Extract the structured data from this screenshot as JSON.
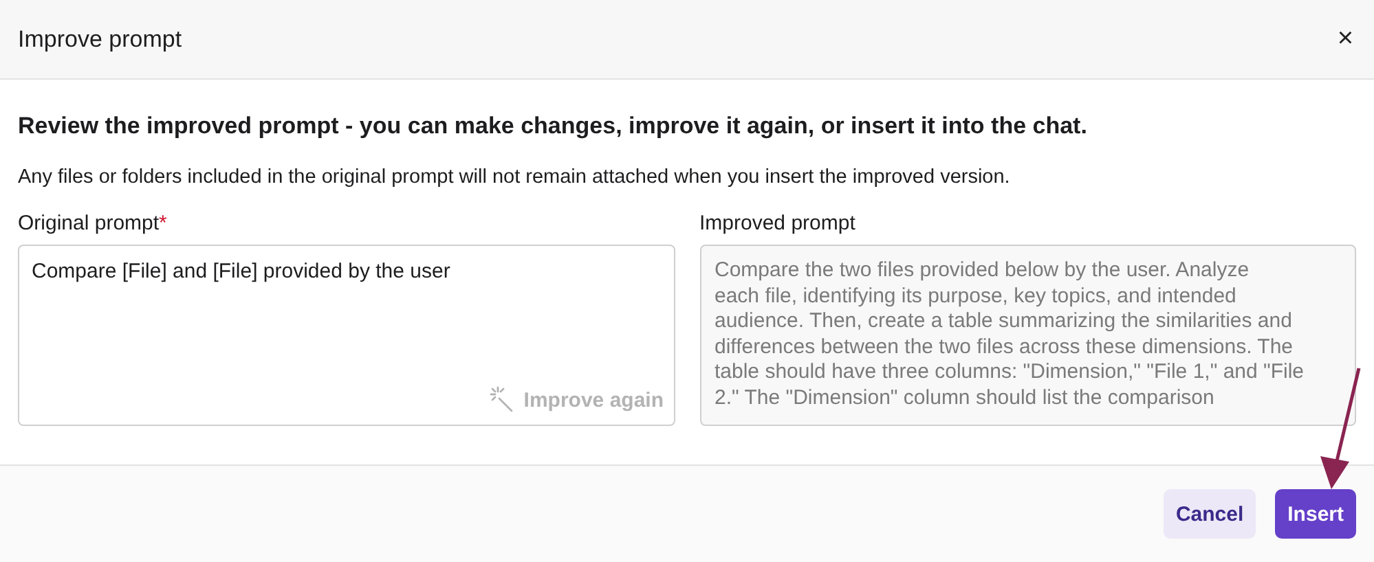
{
  "window": {
    "title": "Improve prompt",
    "close": "×"
  },
  "heading": "Review the improved prompt - you can make changes, improve it again, or insert it into the chat.",
  "note": "Any files or folders included in the original prompt will not remain attached when you insert the improved version.",
  "original": {
    "label": "Original prompt",
    "required_mark": "*",
    "value": "Compare [File] and [File] provided by the user",
    "action": {
      "label": "Improve again",
      "disabled": true
    }
  },
  "improved": {
    "label": "Improved prompt",
    "lines": [
      "Compare the two files provided below by the user. Analyze",
      "each file, identifying its purpose, key topics, and intended",
      "audience. Then, create a table summarizing the similarities and",
      "differences between the two files across these dimensions. The",
      "table should have three columns: \"Dimension,\" \"File 1,\" and \"File",
      "2.\" The \"Dimension\" column should list the comparison"
    ]
  },
  "buttons": [
    {
      "label": "Cancel",
      "kind": "secondary"
    },
    {
      "label": "Insert",
      "kind": "primary"
    }
  ]
}
